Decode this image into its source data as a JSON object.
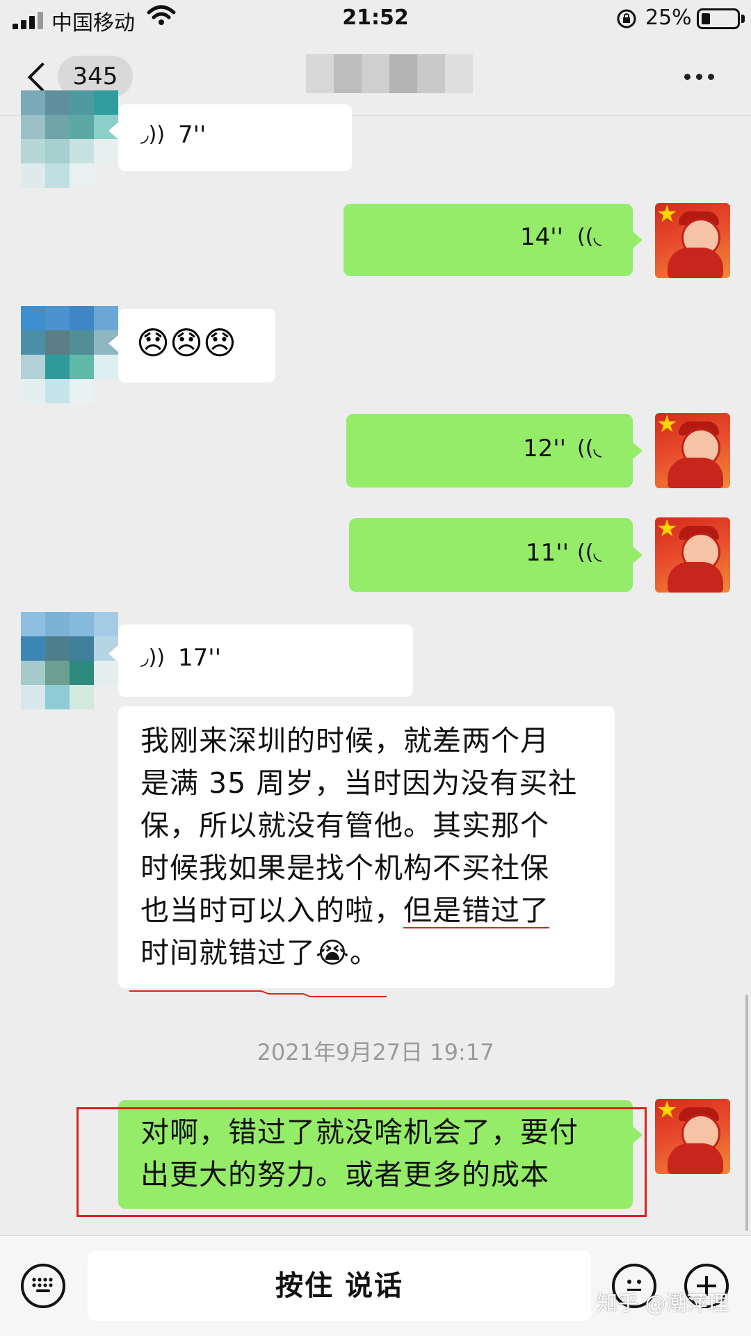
{
  "status_bar": {
    "carrier": "中国移动",
    "time": "21:52",
    "battery": "25%",
    "battery_level": 0.25
  },
  "nav": {
    "unread_count": "345",
    "more_icon": "more-dots-icon"
  },
  "messages": [
    {
      "side": "in",
      "type": "voice",
      "duration": "7''"
    },
    {
      "side": "out",
      "type": "voice",
      "duration": "14''"
    },
    {
      "side": "in",
      "type": "emoji",
      "emojis": "😞😞😞"
    },
    {
      "side": "out",
      "type": "voice",
      "duration": "12''"
    },
    {
      "side": "out",
      "type": "voice",
      "duration": "11''"
    },
    {
      "side": "in",
      "type": "voice",
      "duration": "17''"
    },
    {
      "side": "in",
      "type": "text",
      "lines": [
        "我刚来深圳的时候，就差两个月",
        "是满 35 周岁，当时因为没有买社",
        "保，所以就没有管他。其实那个",
        "时候我如果是找个机构不买社保"
      ],
      "line5_plain": "也当时可以入的啦，",
      "line5_marked": "但是错过了",
      "line6_text": "时间就错过了",
      "line6_emoji": "😭",
      "line6_end": "。"
    },
    {
      "side": "out",
      "type": "text",
      "lines": [
        "对啊，错过了就没啥机会了，要付",
        "出更大的努力。或者更多的成本"
      ]
    }
  ],
  "timestamp": "2021年9月27日 19:17",
  "input_bar": {
    "hold_to_talk": "按住 说话"
  },
  "watermark": "知乎 @潮萍理",
  "colors": {
    "bubble_out": "#95ec69",
    "bubble_in": "#ffffff",
    "background": "#ededed",
    "highlight": "#d8261c"
  }
}
